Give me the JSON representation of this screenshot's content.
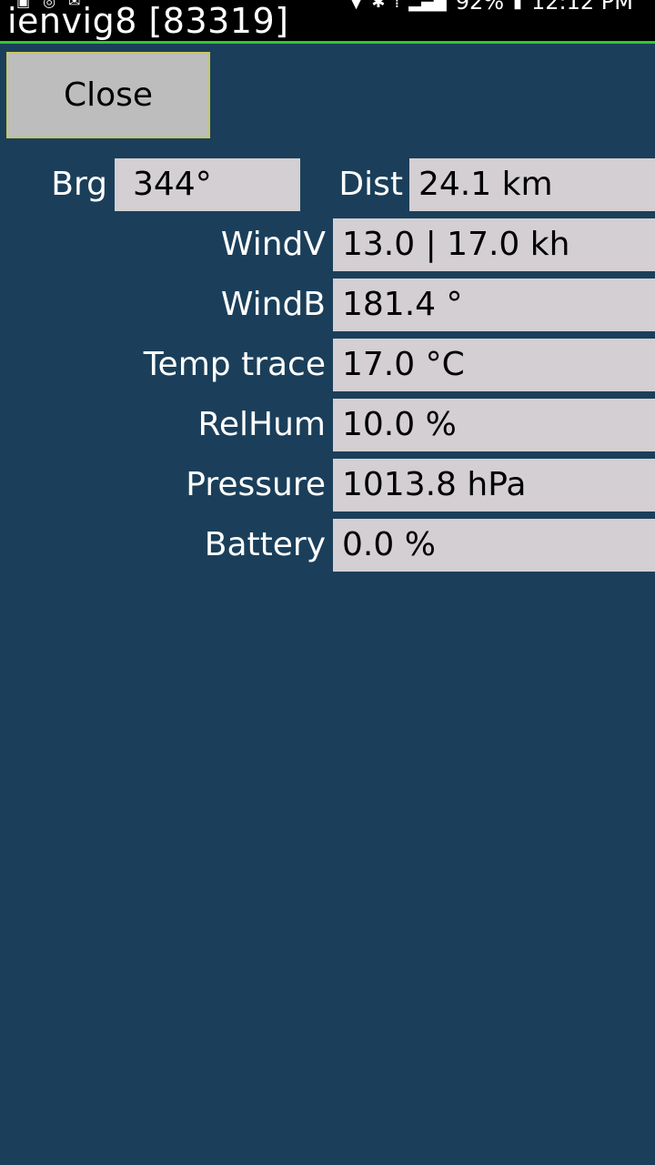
{
  "status_bar": {
    "battery": "92%",
    "time": "12:12 PM",
    "icons_left": [
      "image-icon",
      "sync-icon",
      "gmail-icon"
    ],
    "icons_right": [
      "location-icon",
      "bluetooth-icon",
      "vibrate-icon",
      "signal-icon",
      "battery-icon"
    ]
  },
  "title": "ienvig8 [83319]",
  "close_label": "Close",
  "bearing": {
    "label": "Brg",
    "value": "344°"
  },
  "distance": {
    "label": "Dist",
    "value": "24.1 km"
  },
  "rows": [
    {
      "label": "WindV",
      "value": "13.0 | 17.0 kh"
    },
    {
      "label": "WindB",
      "value": "181.4 °"
    },
    {
      "label": "Temp trace",
      "value": "17.0 °C"
    },
    {
      "label": "RelHum",
      "value": "10.0 %"
    },
    {
      "label": "Pressure",
      "value": "1013.8 hPa"
    },
    {
      "label": "Battery",
      "value": "0.0 %"
    }
  ],
  "colors": {
    "background": "#1b3f5a",
    "titlebar": "#000000",
    "accent_line": "#32c832",
    "field_bg": "#d3cfd3",
    "button_bg": "#bdbdbd"
  }
}
